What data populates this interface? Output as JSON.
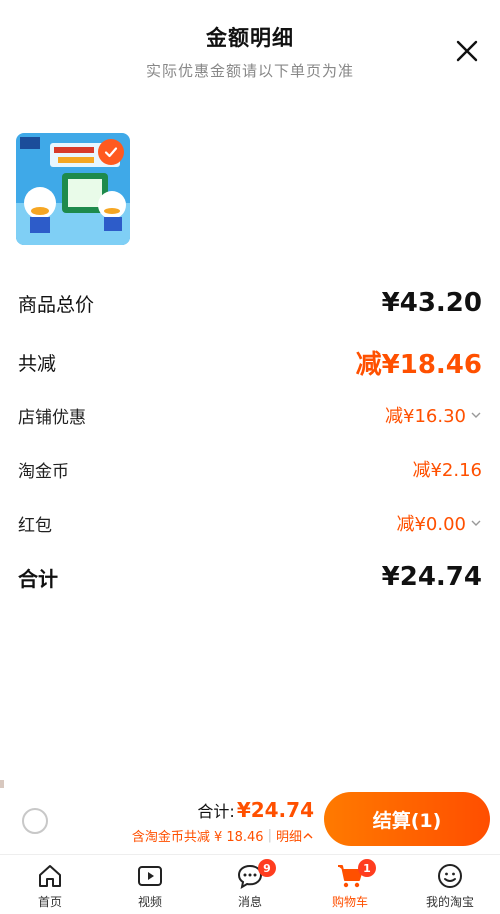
{
  "header": {
    "title": "金额明细",
    "subtitle": "实际优惠金额请以下单页为准"
  },
  "product": {
    "image_icon": "product-thumbnail",
    "selected": true
  },
  "rows": {
    "total_price": {
      "label": "商品总价",
      "value": "¥43.20"
    },
    "total_reduce": {
      "label": "共减",
      "value": "减¥18.46"
    },
    "store_discount": {
      "label": "店铺优惠",
      "value": "减¥16.30"
    },
    "taojinbi": {
      "label": "淘金币",
      "value": "减¥2.16"
    },
    "red_packet": {
      "label": "红包",
      "value": "减¥0.00"
    },
    "sum": {
      "label": "合计",
      "value": "¥24.74"
    }
  },
  "bottom_bar": {
    "total_label": "合计:",
    "total_amount": "¥24.74",
    "discount_text": "含淘金币共减 ¥ 18.46",
    "detail_label": "明细",
    "checkout_label": "结算(1)"
  },
  "tabbar": [
    {
      "label": "首页",
      "icon": "home-icon"
    },
    {
      "label": "视频",
      "icon": "video-icon"
    },
    {
      "label": "消息",
      "icon": "message-icon",
      "badge": "9"
    },
    {
      "label": "购物车",
      "icon": "cart-icon",
      "badge": "1",
      "active": true
    },
    {
      "label": "我的淘宝",
      "icon": "profile-icon"
    }
  ],
  "colors": {
    "accent": "#ff5000",
    "checkout_gradient_start": "#ff7a00",
    "checkout_gradient_end": "#ff4e00"
  }
}
